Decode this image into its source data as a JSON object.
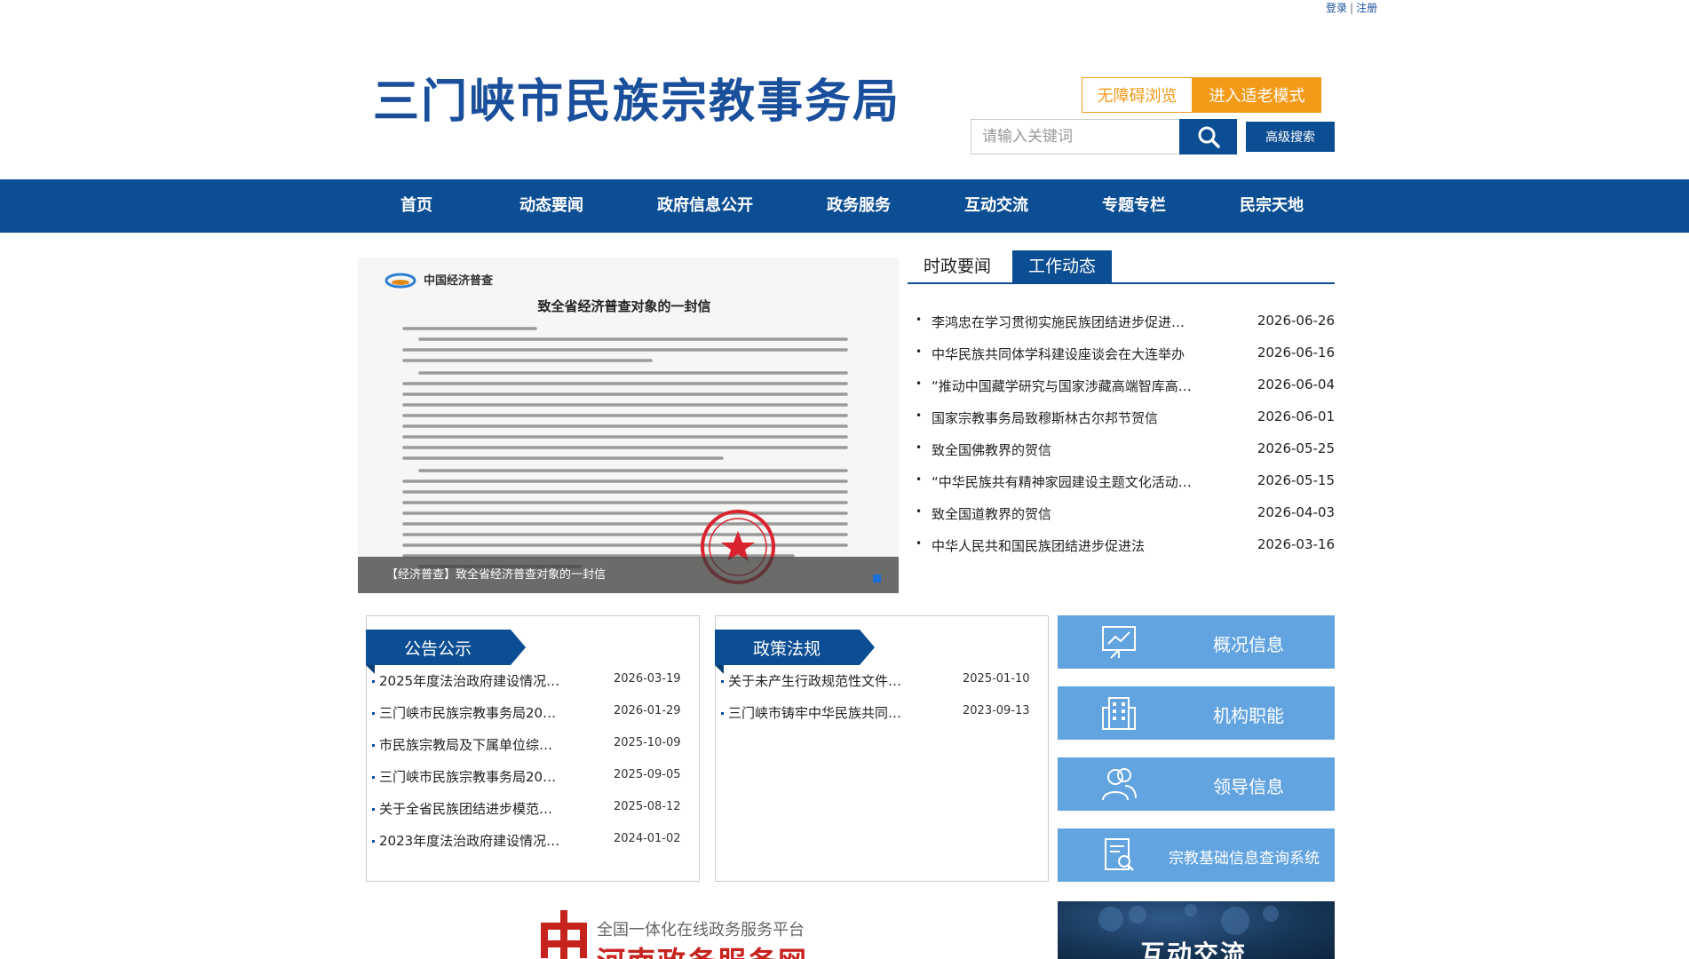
{
  "top_links": {
    "login": "登录",
    "separator": "|",
    "register": "注册"
  },
  "header": {
    "title": "三门峡市民族宗教事务局",
    "a11y_button": "无障碍浏览",
    "elder_button": "进入适老模式",
    "search_placeholder": "请输入关键词",
    "advanced_search": "高级搜索"
  },
  "nav": [
    "首页",
    "动态要闻",
    "政府信息公开",
    "政务服务",
    "互动交流",
    "专题专栏",
    "民宗天地"
  ],
  "carousel": {
    "caption": "【经济普查】致全省经济普查对象的一封信",
    "doc_header": "中国经济普查",
    "doc_title": "致全省经济普查对象的一封信"
  },
  "news": {
    "tabs": [
      "时政要闻",
      "工作动态"
    ],
    "active_tab": 1,
    "items": [
      {
        "title": "李鸿忠在学习贯彻实施民族团结进步促进…",
        "date": "2026-06-26"
      },
      {
        "title": "中华民族共同体学科建设座谈会在大连举办",
        "date": "2026-06-16"
      },
      {
        "title": "“推动中国藏学研究与国家涉藏高端智库高…",
        "date": "2026-06-04"
      },
      {
        "title": "国家宗教事务局致穆斯林古尔邦节贺信",
        "date": "2026-06-01"
      },
      {
        "title": "致全国佛教界的贺信",
        "date": "2026-05-25"
      },
      {
        "title": "“中华民族共有精神家园建设主题文化活动…",
        "date": "2026-05-15"
      },
      {
        "title": "致全国道教界的贺信",
        "date": "2026-04-03"
      },
      {
        "title": "中华人民共和国民族团结进步促进法",
        "date": "2026-03-16"
      }
    ]
  },
  "notices": {
    "title": "公告公示",
    "items": [
      {
        "title": "2025年度法治政府建设情况…",
        "date": "2026-03-19"
      },
      {
        "title": "三门峡市民族宗教事务局20…",
        "date": "2026-01-29"
      },
      {
        "title": "市民族宗教局及下属单位综…",
        "date": "2025-10-09"
      },
      {
        "title": "三门峡市民族宗教事务局20…",
        "date": "2025-09-05"
      },
      {
        "title": "关于全省民族团结进步模范…",
        "date": "2025-08-12"
      },
      {
        "title": "2023年度法治政府建设情况…",
        "date": "2024-01-02"
      }
    ]
  },
  "policies": {
    "title": "政策法规",
    "items": [
      {
        "title": "关于未产生行政规范性文件…",
        "date": "2025-01-10"
      },
      {
        "title": "三门峡市铸牢中华民族共同…",
        "date": "2023-09-13"
      }
    ]
  },
  "side_buttons": [
    {
      "label": "概况信息",
      "icon": "chart-board-icon"
    },
    {
      "label": "机构职能",
      "icon": "building-icon"
    },
    {
      "label": "领导信息",
      "icon": "people-icon"
    },
    {
      "label": "宗教基础信息查询系统",
      "icon": "document-search-icon"
    }
  ],
  "footer_banners": {
    "gov_platform_sub": "全国一体化在线政务服务平台",
    "gov_platform_main": "河南政务服务网",
    "interact": "互动交流"
  },
  "colors": {
    "primary": "#0c4e93",
    "accent_orange": "#f39a18",
    "side_blue": "#62a4e0",
    "gov_red": "#c7231e"
  }
}
